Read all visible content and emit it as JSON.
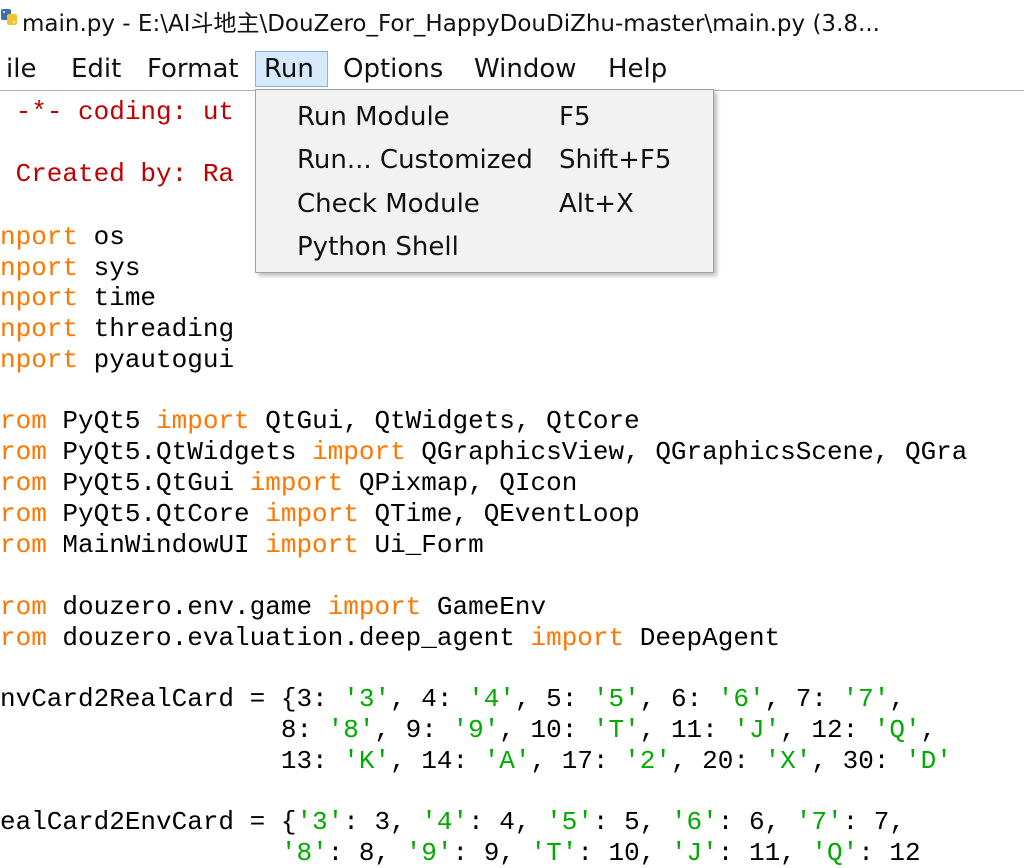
{
  "window": {
    "title": "main.py - E:\\AI斗地主\\DouZero_For_HappyDouDiZhu-master\\main.py (3.8..."
  },
  "icons": {
    "app": "python-idle-icon"
  },
  "colors": {
    "comment": "#c00000",
    "keyword": "#ff7700",
    "string": "#00aa00",
    "menu_highlight": "#d6e8fb"
  },
  "menubar": {
    "items": [
      "ile",
      "Edit",
      "Format",
      "Run",
      "Options",
      "Window",
      "Help"
    ],
    "active": "Run"
  },
  "run_menu": {
    "items": [
      {
        "label": "Run Module",
        "shortcut": "F5"
      },
      {
        "label": "Run... Customized",
        "shortcut": "Shift+F5"
      },
      {
        "label": "Check Module",
        "shortcut": "Alt+X"
      },
      {
        "label": "Python Shell",
        "shortcut": ""
      }
    ]
  },
  "code": {
    "lines": [
      [
        {
          "t": " -*- coding: ut",
          "c": "comment"
        }
      ],
      [
        {
          "t": " Created by: Ra",
          "c": "comment"
        }
      ],
      [
        {
          "t": "nport",
          "c": "kw"
        },
        {
          "t": " os",
          "c": "def"
        }
      ],
      [
        {
          "t": "nport",
          "c": "kw"
        },
        {
          "t": " sys",
          "c": "def"
        }
      ],
      [
        {
          "t": "nport",
          "c": "kw"
        },
        {
          "t": " time",
          "c": "def"
        }
      ],
      [
        {
          "t": "nport",
          "c": "kw"
        },
        {
          "t": " threading",
          "c": "def"
        }
      ],
      [
        {
          "t": "nport",
          "c": "kw"
        },
        {
          "t": " pyautogui",
          "c": "def"
        }
      ],
      [
        {
          "t": "rom",
          "c": "kw"
        },
        {
          "t": " PyQt5 ",
          "c": "def"
        },
        {
          "t": "import",
          "c": "kw"
        },
        {
          "t": " QtGui, QtWidgets, QtCore",
          "c": "def"
        }
      ],
      [
        {
          "t": "rom",
          "c": "kw"
        },
        {
          "t": " PyQt5.QtWidgets ",
          "c": "def"
        },
        {
          "t": "import",
          "c": "kw"
        },
        {
          "t": " QGraphicsView, QGraphicsScene, QGra",
          "c": "def"
        }
      ],
      [
        {
          "t": "rom",
          "c": "kw"
        },
        {
          "t": " PyQt5.QtGui ",
          "c": "def"
        },
        {
          "t": "import",
          "c": "kw"
        },
        {
          "t": " QPixmap, QIcon",
          "c": "def"
        }
      ],
      [
        {
          "t": "rom",
          "c": "kw"
        },
        {
          "t": " PyQt5.QtCore ",
          "c": "def"
        },
        {
          "t": "import",
          "c": "kw"
        },
        {
          "t": " QTime, QEventLoop",
          "c": "def"
        }
      ],
      [
        {
          "t": "rom",
          "c": "kw"
        },
        {
          "t": " MainWindowUI ",
          "c": "def"
        },
        {
          "t": "import",
          "c": "kw"
        },
        {
          "t": " Ui_Form",
          "c": "def"
        }
      ],
      [
        {
          "t": "rom",
          "c": "kw"
        },
        {
          "t": " douzero.env.game ",
          "c": "def"
        },
        {
          "t": "import",
          "c": "kw"
        },
        {
          "t": " GameEnv",
          "c": "def"
        }
      ],
      [
        {
          "t": "rom",
          "c": "kw"
        },
        {
          "t": " douzero.evaluation.deep_agent ",
          "c": "def"
        },
        {
          "t": "import",
          "c": "kw"
        },
        {
          "t": " DeepAgent",
          "c": "def"
        }
      ],
      [
        {
          "t": "nvCard2RealCard = {3: ",
          "c": "def"
        },
        {
          "t": "'3'",
          "c": "str"
        },
        {
          "t": ", 4: ",
          "c": "def"
        },
        {
          "t": "'4'",
          "c": "str"
        },
        {
          "t": ", 5: ",
          "c": "def"
        },
        {
          "t": "'5'",
          "c": "str"
        },
        {
          "t": ", 6: ",
          "c": "def"
        },
        {
          "t": "'6'",
          "c": "str"
        },
        {
          "t": ", 7: ",
          "c": "def"
        },
        {
          "t": "'7'",
          "c": "str"
        },
        {
          "t": ",",
          "c": "def"
        }
      ],
      [
        {
          "t": "                  8: ",
          "c": "def"
        },
        {
          "t": "'8'",
          "c": "str"
        },
        {
          "t": ", 9: ",
          "c": "def"
        },
        {
          "t": "'9'",
          "c": "str"
        },
        {
          "t": ", 10: ",
          "c": "def"
        },
        {
          "t": "'T'",
          "c": "str"
        },
        {
          "t": ", 11: ",
          "c": "def"
        },
        {
          "t": "'J'",
          "c": "str"
        },
        {
          "t": ", 12: ",
          "c": "def"
        },
        {
          "t": "'Q'",
          "c": "str"
        },
        {
          "t": ",",
          "c": "def"
        }
      ],
      [
        {
          "t": "                  13: ",
          "c": "def"
        },
        {
          "t": "'K'",
          "c": "str"
        },
        {
          "t": ", 14: ",
          "c": "def"
        },
        {
          "t": "'A'",
          "c": "str"
        },
        {
          "t": ", 17: ",
          "c": "def"
        },
        {
          "t": "'2'",
          "c": "str"
        },
        {
          "t": ", 20: ",
          "c": "def"
        },
        {
          "t": "'X'",
          "c": "str"
        },
        {
          "t": ", 30: ",
          "c": "def"
        },
        {
          "t": "'D'",
          "c": "str"
        }
      ],
      [
        {
          "t": "ealCard2EnvCard = {",
          "c": "def"
        },
        {
          "t": "'3'",
          "c": "str"
        },
        {
          "t": ": 3, ",
          "c": "def"
        },
        {
          "t": "'4'",
          "c": "str"
        },
        {
          "t": ": 4, ",
          "c": "def"
        },
        {
          "t": "'5'",
          "c": "str"
        },
        {
          "t": ": 5, ",
          "c": "def"
        },
        {
          "t": "'6'",
          "c": "str"
        },
        {
          "t": ": 6, ",
          "c": "def"
        },
        {
          "t": "'7'",
          "c": "str"
        },
        {
          "t": ": 7,",
          "c": "def"
        }
      ],
      [
        {
          "t": "                  ",
          "c": "def"
        },
        {
          "t": "'8'",
          "c": "str"
        },
        {
          "t": ": 8, ",
          "c": "def"
        },
        {
          "t": "'9'",
          "c": "str"
        },
        {
          "t": ": 9, ",
          "c": "def"
        },
        {
          "t": "'T'",
          "c": "str"
        },
        {
          "t": ": 10, ",
          "c": "def"
        },
        {
          "t": "'J'",
          "c": "str"
        },
        {
          "t": ": 11, ",
          "c": "def"
        },
        {
          "t": "'Q'",
          "c": "str"
        },
        {
          "t": ": 12",
          "c": "def"
        }
      ]
    ]
  }
}
